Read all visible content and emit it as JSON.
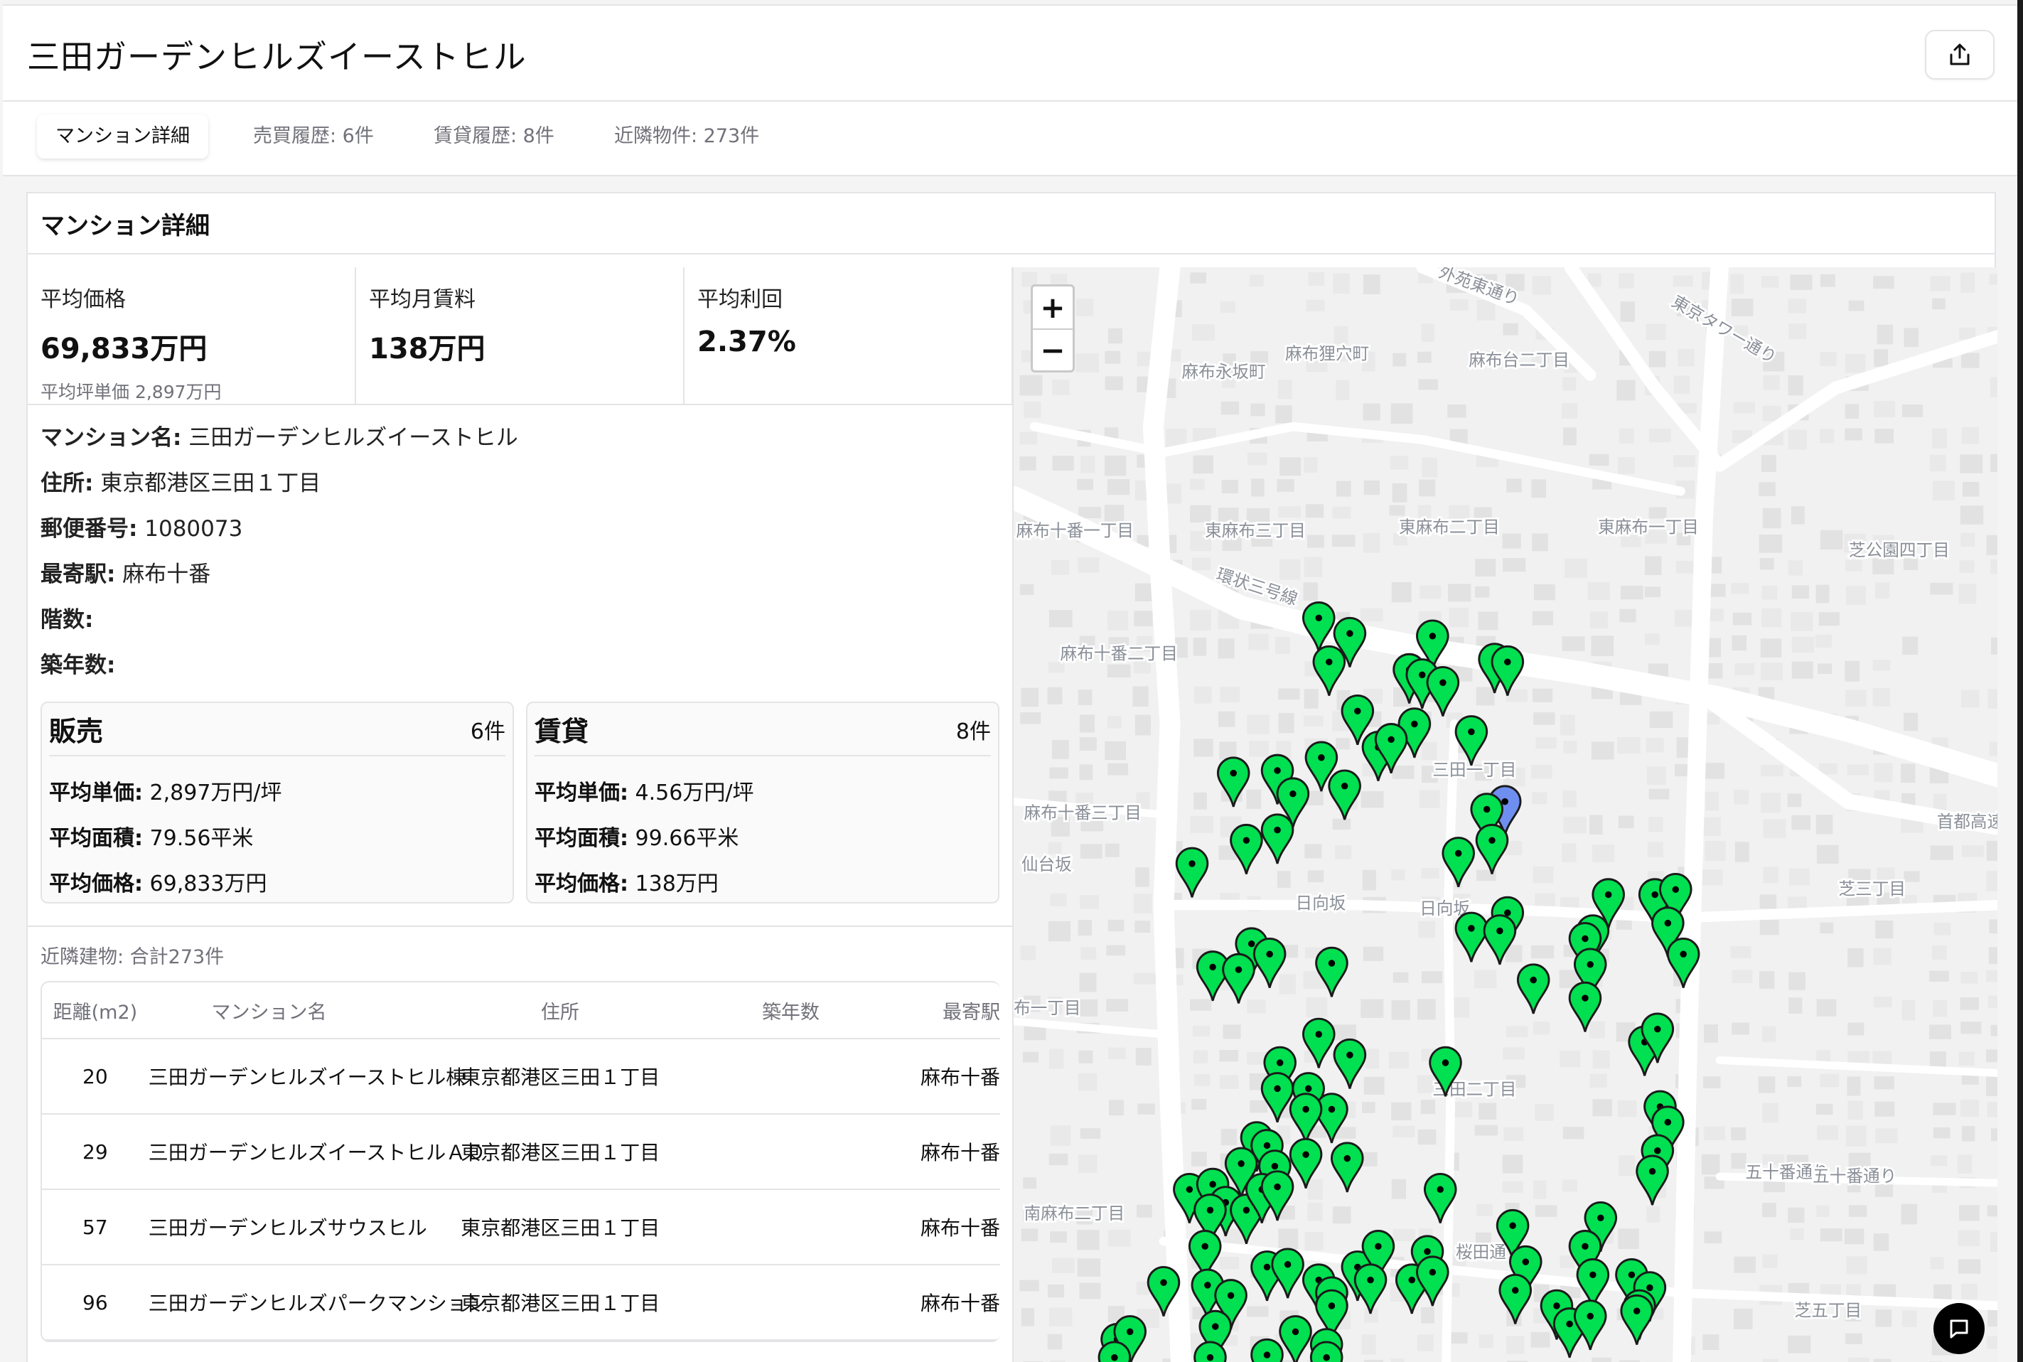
{
  "header": {
    "title": "三田ガーデンヒルズイーストヒル",
    "share_icon": "share-icon"
  },
  "tabs": [
    {
      "label": "マンション詳細",
      "active": true
    },
    {
      "label": "売買履歴: 6件"
    },
    {
      "label": "賃貸履歴: 8件"
    },
    {
      "label": "近隣物件: 273件"
    }
  ],
  "card": {
    "title": "マンション詳細"
  },
  "stats": [
    {
      "label": "平均価格",
      "value": "69,833万円",
      "sub": "平均坪単価 2,897万円"
    },
    {
      "label": "平均月賃料",
      "value": "138万円"
    },
    {
      "label": "平均利回",
      "value": "2.37%"
    }
  ],
  "details": [
    {
      "label": "マンション名:",
      "value": " 三田ガーデンヒルズイーストヒル"
    },
    {
      "label": "住所:",
      "value": " 東京都港区三田１丁目"
    },
    {
      "label": "郵便番号:",
      "value": " 1080073"
    },
    {
      "label": "最寄駅:",
      "value": " 麻布十番"
    },
    {
      "label": "階数:",
      "value": ""
    },
    {
      "label": "築年数:",
      "value": ""
    }
  ],
  "sales": {
    "title": "販売",
    "count": "6件",
    "rows": [
      {
        "label": "平均単価:",
        "value": " 2,897万円/坪"
      },
      {
        "label": "平均面積:",
        "value": " 79.56平米"
      },
      {
        "label": "平均価格:",
        "value": " 69,833万円"
      }
    ]
  },
  "rental": {
    "title": "賃貸",
    "count": "8件",
    "rows": [
      {
        "label": "平均単価:",
        "value": " 4.56万円/坪"
      },
      {
        "label": "平均面積:",
        "value": " 99.66平米"
      },
      {
        "label": "平均価格:",
        "value": " 138万円"
      }
    ]
  },
  "nearby": {
    "title": "近隣建物: 合計273件",
    "columns": [
      "距離(m2)",
      "マンション名",
      "住所",
      "築年数",
      "最寄駅"
    ],
    "rows": [
      [
        "20",
        "三田ガーデンヒルズイーストヒル棟",
        "東京都港区三田１丁目",
        "",
        "麻布十番"
      ],
      [
        "29",
        "三田ガーデンヒルズイーストヒルＡＤ",
        "東京都港区三田１丁目",
        "",
        "麻布十番"
      ],
      [
        "57",
        "三田ガーデンヒルズサウスヒル",
        "東京都港区三田１丁目",
        "",
        "麻布十番"
      ],
      [
        "96",
        "三田ガーデンヒルズパークマンション",
        "東京都港区三田１丁目",
        "",
        "麻布十番"
      ]
    ]
  },
  "map": {
    "zoom_in": "+",
    "zoom_out": "−",
    "marker_color": "#00e050",
    "selected_marker_color": "#6f8ff0",
    "labels": [
      "麻布狸穴町",
      "麻布永坂町",
      "麻布台二丁目",
      "麻布十番一丁目",
      "東麻布三丁目",
      "東麻布二丁目",
      "東麻布一丁目",
      "芝公園四丁目",
      "環状三号線",
      "麻布十番二丁目",
      "三田一丁目",
      "麻布十番三丁目",
      "芝三丁目",
      "日向坂",
      "日向坂",
      "布一丁目",
      "三田二丁目",
      "南麻布二丁目",
      "桜田通",
      "芝五丁目",
      "外苑東通り",
      "東京タワー通り",
      "五十番通り",
      "五十番通り",
      "仙台坂",
      "首都高速"
    ]
  }
}
